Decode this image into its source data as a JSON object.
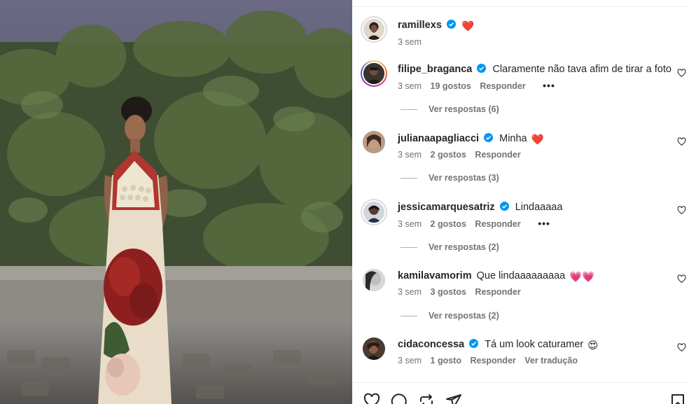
{
  "post": {
    "photo_description_icon": "photo"
  },
  "colors": {
    "text": "#262626",
    "muted": "#737373",
    "verified": "#0095f6",
    "heart": "#ed4956"
  },
  "comments": [
    {
      "username": "ramillexs",
      "verified": true,
      "text": "",
      "emoji": "❤️",
      "time": "3 sem",
      "likes": "",
      "reply": "",
      "more": false,
      "view_replies": ""
    },
    {
      "username": "filipe_braganca",
      "verified": true,
      "text": "Claramente não tava afim de tirar a foto",
      "emoji": "",
      "time": "3 sem",
      "likes": "19 gostos",
      "reply": "Responder",
      "more": true,
      "view_replies": "Ver respostas (6)"
    },
    {
      "username": "julianaapagliacci",
      "verified": true,
      "text": "Minha",
      "emoji": "❤️",
      "time": "3 sem",
      "likes": "2 gostos",
      "reply": "Responder",
      "more": false,
      "view_replies": "Ver respostas (3)"
    },
    {
      "username": "jessicamarquesatriz",
      "verified": true,
      "text": "Lindaaaaa",
      "emoji": "",
      "time": "3 sem",
      "likes": "2 gostos",
      "reply": "Responder",
      "more": true,
      "view_replies": "Ver respostas (2)"
    },
    {
      "username": "kamilavamorim",
      "verified": false,
      "text": "Que lindaaaaaaaaa",
      "emoji": "💗💗",
      "time": "3 sem",
      "likes": "3 gostos",
      "reply": "Responder",
      "more": false,
      "view_replies": "Ver respostas (2)"
    },
    {
      "username": "cidaconcessa",
      "verified": true,
      "text": "Tá um look caturamer",
      "emoji": "😍",
      "time": "3 sem",
      "likes": "1 gosto",
      "reply": "Responder",
      "translate": "Ver tradução",
      "more": false,
      "view_replies": ""
    }
  ],
  "actions": {
    "like_icon": "heart-icon",
    "comment_icon": "comment-icon",
    "share_icon": "repost-icon",
    "send_icon": "send-icon",
    "save_icon": "bookmark-icon"
  }
}
